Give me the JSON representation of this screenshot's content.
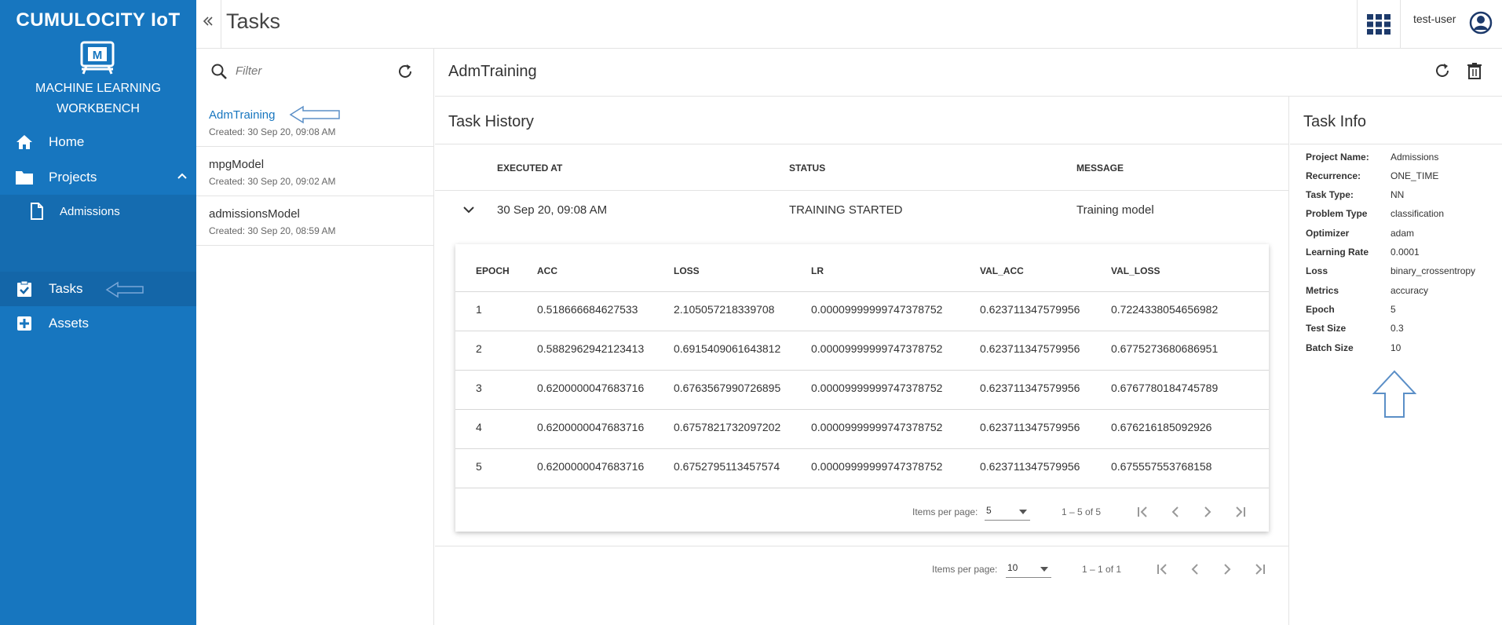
{
  "sidebar": {
    "brand": "CUMULOCITY IoT",
    "app_name_line1": "MACHINE LEARNING",
    "app_name_line2": "WORKBENCH",
    "items": [
      {
        "label": "Home",
        "icon": "home-icon"
      },
      {
        "label": "Projects",
        "icon": "folder-icon"
      },
      {
        "label": "Admissions",
        "icon": "file-icon"
      },
      {
        "label": "Tasks",
        "icon": "clipboard-check-icon"
      },
      {
        "label": "Assets",
        "icon": "assets-icon"
      }
    ]
  },
  "topbar": {
    "title": "Tasks",
    "user": "test-user"
  },
  "task_list": {
    "filter_placeholder": "Filter",
    "tasks": [
      {
        "name": "AdmTraining",
        "created": "Created: 30 Sep 20, 09:08 AM"
      },
      {
        "name": "mpgModel",
        "created": "Created: 30 Sep 20, 09:02 AM"
      },
      {
        "name": "admissionsModel",
        "created": "Created: 30 Sep 20, 08:59 AM"
      }
    ]
  },
  "main": {
    "title": "AdmTraining"
  },
  "history": {
    "title": "Task History",
    "columns": [
      "EXECUTED AT",
      "STATUS",
      "MESSAGE"
    ],
    "row": {
      "executed_at": "30 Sep 20, 09:08 AM",
      "status": "TRAINING STARTED",
      "message": "Training model"
    },
    "epoch_table": {
      "columns": [
        "EPOCH",
        "ACC",
        "LOSS",
        "LR",
        "VAL_ACC",
        "VAL_LOSS"
      ],
      "rows": [
        [
          "1",
          "0.518666684627533",
          "2.105057218339708",
          "0.00009999999747378752",
          "0.623711347579956",
          "0.7224338054656982"
        ],
        [
          "2",
          "0.5882962942123413",
          "0.6915409061643812",
          "0.00009999999747378752",
          "0.623711347579956",
          "0.6775273680686951"
        ],
        [
          "3",
          "0.6200000047683716",
          "0.6763567990726895",
          "0.00009999999747378752",
          "0.623711347579956",
          "0.6767780184745789"
        ],
        [
          "4",
          "0.6200000047683716",
          "0.6757821732097202",
          "0.00009999999747378752",
          "0.623711347579956",
          "0.676216185092926"
        ],
        [
          "5",
          "0.6200000047683716",
          "0.6752795113457574",
          "0.00009999999747378752",
          "0.623711347579956",
          "0.675557553768158"
        ]
      ],
      "paginator": {
        "items_per_page_label": "Items per page:",
        "items_per_page": "5",
        "range": "1 – 5 of 5"
      }
    },
    "paginator": {
      "items_per_page_label": "Items per page:",
      "items_per_page": "10",
      "range": "1 – 1 of 1"
    }
  },
  "info": {
    "title": "Task Info",
    "fields": [
      {
        "key": "Project Name:",
        "value": "Admissions"
      },
      {
        "key": "Recurrence:",
        "value": "ONE_TIME"
      },
      {
        "key": "Task Type:",
        "value": "NN"
      },
      {
        "key": "Problem Type",
        "value": "classification"
      },
      {
        "key": "Optimizer",
        "value": "adam"
      },
      {
        "key": "Learning Rate",
        "value": "0.0001"
      },
      {
        "key": "Loss",
        "value": "binary_crossentropy"
      },
      {
        "key": "Metrics",
        "value": "accuracy"
      },
      {
        "key": "Epoch",
        "value": "5"
      },
      {
        "key": "Test Size",
        "value": "0.3"
      },
      {
        "key": "Batch Size",
        "value": "10"
      }
    ]
  },
  "colors": {
    "sidebar": "#1776bf",
    "accent": "#1776bf",
    "annotation_arrow": "#5b8fc7"
  }
}
